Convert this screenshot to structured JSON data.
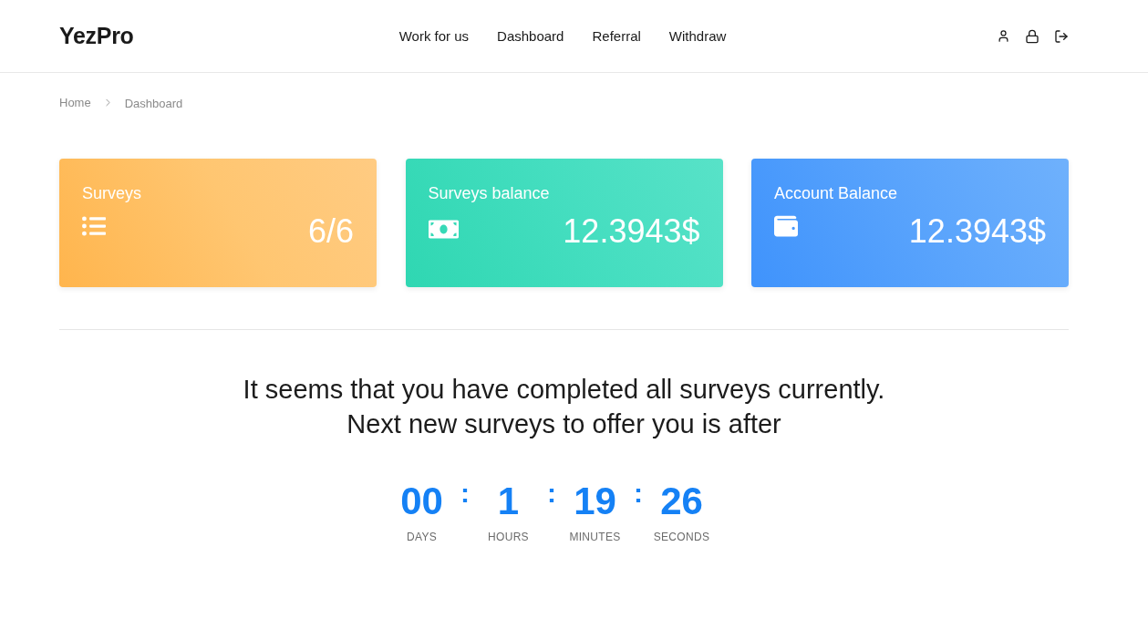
{
  "header": {
    "logo": "YezPro",
    "nav": [
      {
        "label": "Work for us"
      },
      {
        "label": "Dashboard"
      },
      {
        "label": "Referral"
      },
      {
        "label": "Withdraw"
      }
    ]
  },
  "breadcrumb": [
    {
      "label": "Home"
    },
    {
      "label": "Dashboard"
    }
  ],
  "cards": [
    {
      "kind": "surveys",
      "title": "Surveys",
      "value": "6/6"
    },
    {
      "kind": "survey_balance",
      "title": "Surveys balance",
      "value": "12.3943$"
    },
    {
      "kind": "account_balance",
      "title": "Account Balance",
      "value": "12.3943$"
    }
  ],
  "notice": {
    "lines": [
      "It seems that you have completed all surveys currently.",
      "Next new surveys to offer you is after"
    ]
  },
  "countdown": [
    {
      "kind": "unit",
      "value": "00",
      "label": "DAYS"
    },
    {
      "kind": "separator",
      "text": ":"
    },
    {
      "kind": "unit",
      "value": "1",
      "label": "HOURS"
    },
    {
      "kind": "separator",
      "text": ":"
    },
    {
      "kind": "unit",
      "value": "19",
      "label": "MINUTES"
    },
    {
      "kind": "separator",
      "text": ":"
    },
    {
      "kind": "unit",
      "value": "26",
      "label": "SECONDS"
    }
  ]
}
